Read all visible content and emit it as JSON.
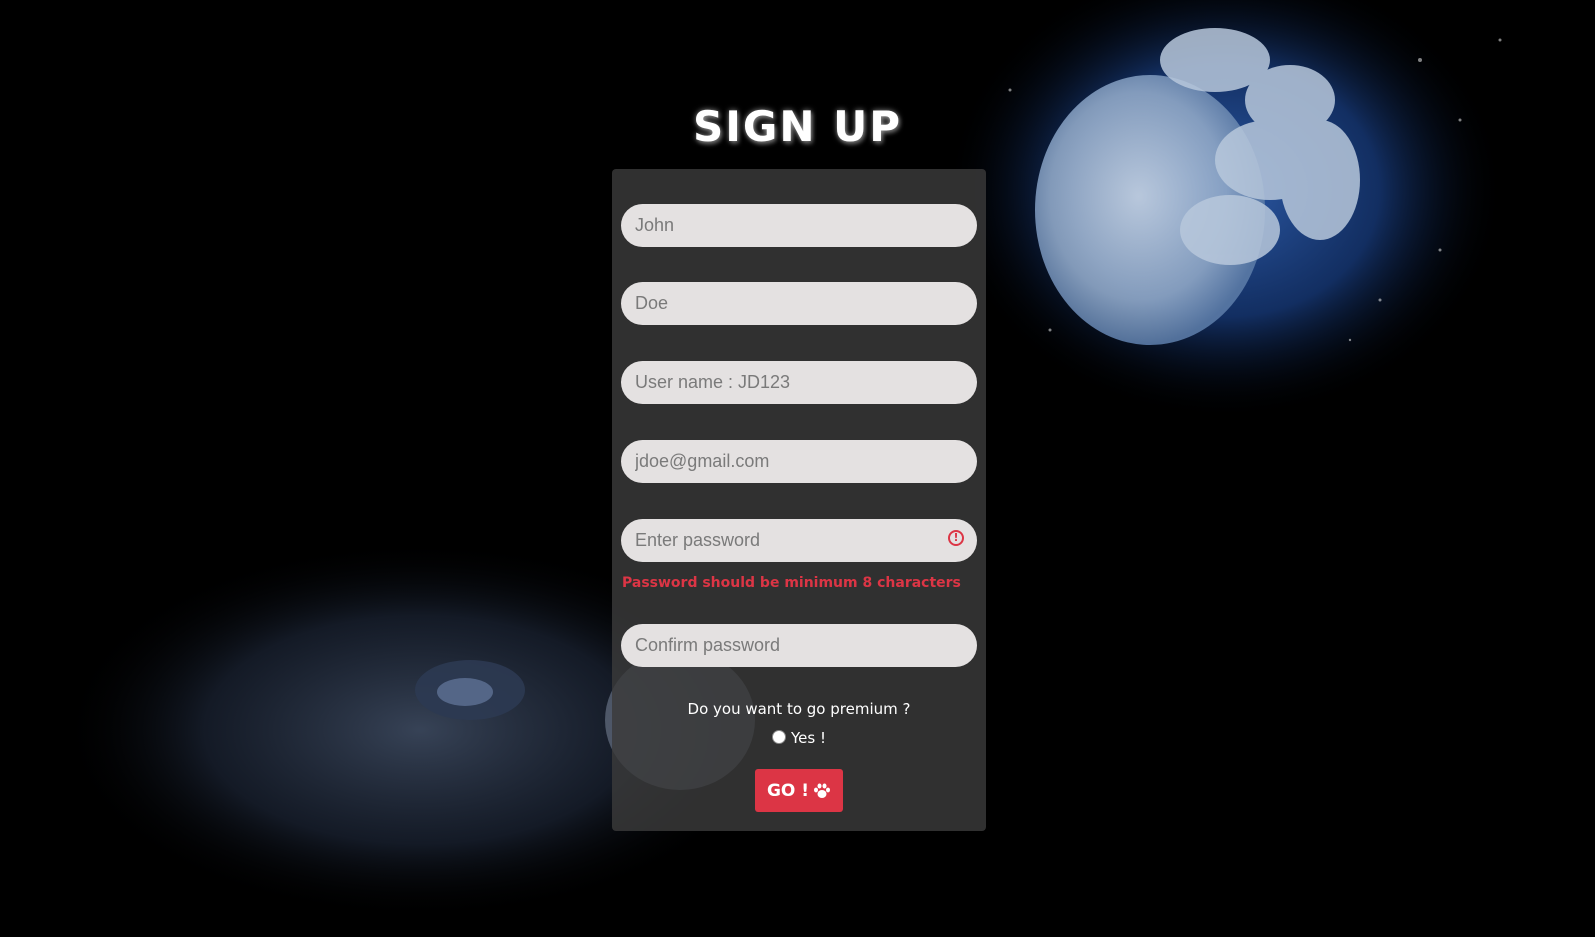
{
  "page": {
    "title": "SIGN UP"
  },
  "form": {
    "first_name_placeholder": "John",
    "last_name_placeholder": "Doe",
    "username_placeholder": "User name : JD123",
    "email_placeholder": "jdoe@gmail.com",
    "password_placeholder": "Enter password",
    "password_error": "Password should be minimum 8 characters",
    "confirm_placeholder": "Confirm password",
    "premium_question": "Do you want to go premium ?",
    "premium_option_label": "Yes !",
    "submit_label": "GO !"
  },
  "icons": {
    "password_alert": "alert-circle-icon",
    "submit": "paw-icon"
  },
  "colors": {
    "accent": "#dc3545",
    "card_bg": "#3a3a3a",
    "input_bg": "#e4e1e1",
    "page_bg": "#000000"
  }
}
